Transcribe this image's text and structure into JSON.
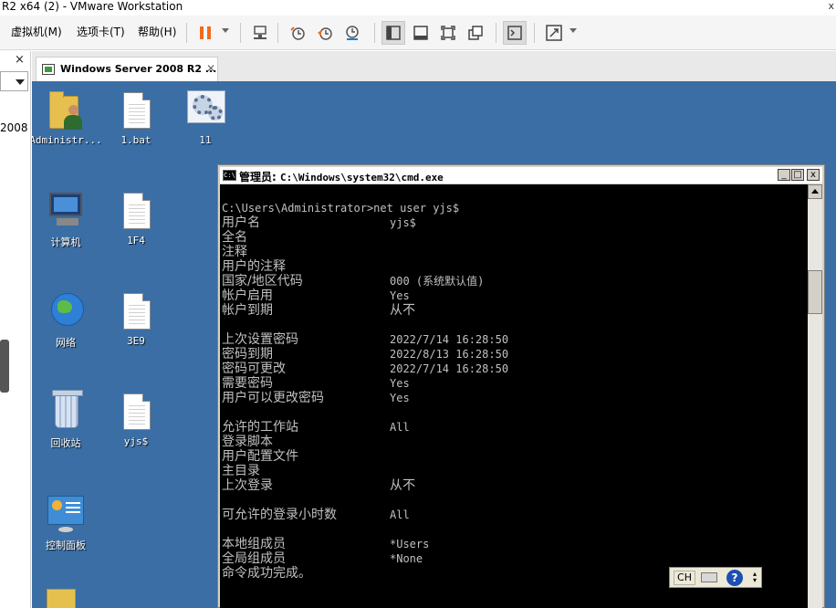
{
  "vmware": {
    "title": "R2 x64 (2) - VMware Workstation",
    "close_glyph": "x",
    "menu": {
      "vm": "虚拟机(M)",
      "tabs": "选项卡(T)",
      "help": "帮助(H)"
    }
  },
  "library": {
    "close_glyph": "×",
    "visible_text": "2008"
  },
  "tab": {
    "label": "Windows Server 2008 R2 ...",
    "close_glyph": "✕"
  },
  "desktop": {
    "icons": [
      {
        "label": "Administr...",
        "kind": "user-folder"
      },
      {
        "label": "1.bat",
        "kind": "document"
      },
      {
        "label": "11",
        "kind": "settings"
      },
      {
        "label": "计算机",
        "kind": "computer"
      },
      {
        "label": "1F4",
        "kind": "document"
      },
      {
        "label": "网络",
        "kind": "network"
      },
      {
        "label": "3E9",
        "kind": "document"
      },
      {
        "label": "回收站",
        "kind": "recycle-bin"
      },
      {
        "label": "yjs$",
        "kind": "document"
      },
      {
        "label": "控制面板",
        "kind": "control-panel"
      }
    ]
  },
  "cmd": {
    "title_prefix": "管理员:",
    "title_path": "C:\\Windows\\system32\\cmd.exe",
    "prompt_line": "C:\\Users\\Administrator>net user yjs$",
    "rows": [
      {
        "key": "用户名",
        "value": "yjs$"
      },
      {
        "key": "全名",
        "value": ""
      },
      {
        "key": "注释",
        "value": ""
      },
      {
        "key": "用户的注释",
        "value": ""
      },
      {
        "key": "国家/地区代码",
        "value": "000 (系统默认值)"
      },
      {
        "key": "帐户启用",
        "value": "Yes"
      },
      {
        "key": "帐户到期",
        "value": "从不"
      },
      {
        "key": "",
        "value": ""
      },
      {
        "key": "上次设置密码",
        "value": "2022/7/14 16:28:50"
      },
      {
        "key": "密码到期",
        "value": "2022/8/13 16:28:50"
      },
      {
        "key": "密码可更改",
        "value": "2022/7/14 16:28:50"
      },
      {
        "key": "需要密码",
        "value": "Yes"
      },
      {
        "key": "用户可以更改密码",
        "value": "Yes"
      },
      {
        "key": "",
        "value": ""
      },
      {
        "key": "允许的工作站",
        "value": "All"
      },
      {
        "key": "登录脚本",
        "value": ""
      },
      {
        "key": "用户配置文件",
        "value": ""
      },
      {
        "key": "主目录",
        "value": ""
      },
      {
        "key": "上次登录",
        "value": "从不"
      },
      {
        "key": "",
        "value": ""
      },
      {
        "key": "可允许的登录小时数",
        "value": "All"
      },
      {
        "key": "",
        "value": ""
      },
      {
        "key": "本地组成员",
        "value": "*Users"
      },
      {
        "key": "全局组成员",
        "value": "*None"
      },
      {
        "key": "命令成功完成。",
        "value": ""
      }
    ],
    "window_buttons": {
      "minimize": "_",
      "maximize": "□",
      "close": "x"
    }
  },
  "langbar": {
    "lang": "CH",
    "help": "?",
    "more": "▴\n▾"
  }
}
